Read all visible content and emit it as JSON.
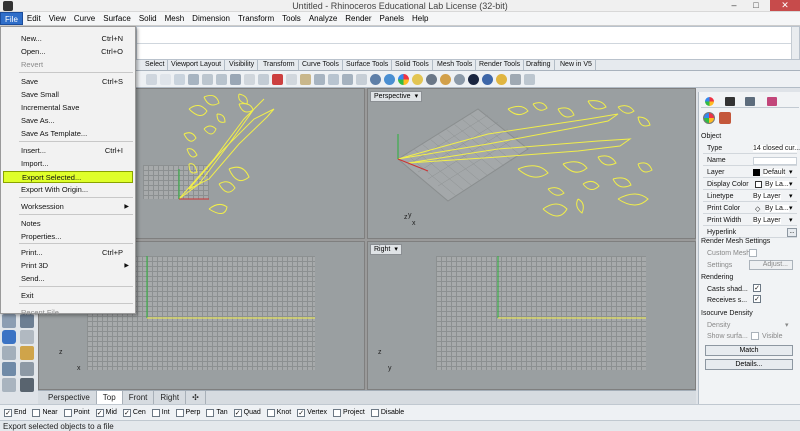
{
  "window": {
    "title": "Untitled - Rhinoceros Educational Lab License (32-bit)",
    "controls": [
      "–",
      "□",
      "✕"
    ]
  },
  "menubar": [
    "File",
    "Edit",
    "View",
    "Curve",
    "Surface",
    "Solid",
    "Mesh",
    "Dimension",
    "Transform",
    "Tools",
    "Analyze",
    "Render",
    "Panels",
    "Help"
  ],
  "file_menu": {
    "items": [
      {
        "label": "New...",
        "shortcut": "Ctrl+N"
      },
      {
        "label": "Open...",
        "shortcut": "Ctrl+O"
      },
      {
        "label": "Revert",
        "shortcut": "",
        "disabled": true
      },
      {
        "label": "Save",
        "shortcut": "Ctrl+S"
      },
      {
        "label": "Save Small",
        "shortcut": ""
      },
      {
        "label": "Incremental Save",
        "shortcut": ""
      },
      {
        "label": "Save As...",
        "shortcut": ""
      },
      {
        "label": "Save As Template...",
        "shortcut": ""
      },
      {
        "label": "Insert...",
        "shortcut": "Ctrl+I"
      },
      {
        "label": "Import...",
        "shortcut": ""
      },
      {
        "label": "Export Selected...",
        "shortcut": "",
        "highlighted": true
      },
      {
        "label": "Export With Origin...",
        "shortcut": ""
      },
      {
        "label": "Worksession",
        "shortcut": "",
        "submenu": true
      },
      {
        "label": "Notes",
        "shortcut": ""
      },
      {
        "label": "Properties...",
        "shortcut": ""
      },
      {
        "label": "Print...",
        "shortcut": "Ctrl+P"
      },
      {
        "label": "Print 3D",
        "shortcut": "",
        "submenu": true
      },
      {
        "label": "Send...",
        "shortcut": ""
      },
      {
        "label": "Exit",
        "shortcut": ""
      },
      {
        "label": "Recent File",
        "shortcut": "",
        "disabled": true
      }
    ]
  },
  "toolbar_tabs": [
    "Select",
    "Viewport Layout",
    "Visibility",
    "Transform",
    "Curve Tools",
    "Surface Tools",
    "Solid Tools",
    "Mesh Tools",
    "Render Tools",
    "Drafting",
    "New in V5"
  ],
  "viewports": {
    "top_right_label": "Perspective",
    "bottom_right_label": "Right",
    "axis_x": "x",
    "axis_y": "y",
    "axis_z": "z"
  },
  "viewport_tabs": [
    "Perspective",
    "Top",
    "Front",
    "Right",
    "✣"
  ],
  "snaps": [
    {
      "label": "End",
      "checked": true
    },
    {
      "label": "Near",
      "checked": false
    },
    {
      "label": "Point",
      "checked": false
    },
    {
      "label": "Mid",
      "checked": true
    },
    {
      "label": "Cen",
      "checked": true
    },
    {
      "label": "Int",
      "checked": false
    },
    {
      "label": "Perp",
      "checked": false
    },
    {
      "label": "Tan",
      "checked": false
    },
    {
      "label": "Quad",
      "checked": true
    },
    {
      "label": "Knot",
      "checked": false
    },
    {
      "label": "Vertex",
      "checked": true
    },
    {
      "label": "Project",
      "checked": false
    },
    {
      "label": "Disable",
      "checked": false
    }
  ],
  "status": "Export selected objects to a file",
  "properties": {
    "section_object": "Object",
    "rows": [
      {
        "label": "Type",
        "value": "14 closed cur..."
      },
      {
        "label": "Name",
        "value": ""
      },
      {
        "label": "Layer",
        "value": "Default"
      },
      {
        "label": "Display Color",
        "value": "By La..."
      },
      {
        "label": "Linetype",
        "value": "By Layer"
      },
      {
        "label": "Print Color",
        "value": "By La..."
      },
      {
        "label": "Print Width",
        "value": "By Layer"
      },
      {
        "label": "Hyperlink",
        "value": ""
      }
    ],
    "render_mesh": {
      "title": "Render Mesh Settings",
      "custom_mesh": "Custom Mesh",
      "settings": "Settings",
      "adjust": "Adjust..."
    },
    "rendering": {
      "title": "Rendering",
      "casts": "Casts shad...",
      "receives": "Receives s..."
    },
    "isocurve": {
      "title": "Isocurve Density",
      "density": "Density",
      "show": "Show surfa...",
      "visible": "Visible"
    },
    "match_button": "Match",
    "details_button": "Details..."
  },
  "colors": {
    "curve": "#f1ee4a",
    "menu_highlight": "#dfff2a",
    "viewport_bg": "#9a9fa1"
  }
}
